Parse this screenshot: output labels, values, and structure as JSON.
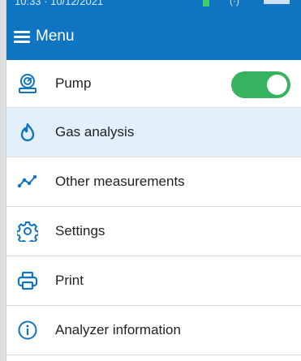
{
  "status_bar": {
    "time": "10:33 · 10/12/2021",
    "signal": "(·)"
  },
  "header": {
    "title": "Menu",
    "menu_icon": "hamburger-menu-icon"
  },
  "menu": {
    "items": [
      {
        "label": "Pump",
        "icon": "pump-icon",
        "toggle_on": true
      },
      {
        "label": "Gas analysis",
        "icon": "flame-icon",
        "active": true
      },
      {
        "label": "Other measurements",
        "icon": "line-graph-icon"
      },
      {
        "label": "Settings",
        "icon": "gear-icon"
      },
      {
        "label": "Print",
        "icon": "printer-icon"
      },
      {
        "label": "Analyzer information",
        "icon": "info-icon"
      }
    ]
  },
  "colors": {
    "header": "#0f75c2",
    "accent_icon": "#0f75c2",
    "active_row": "#e1f0fb",
    "toggle_on": "#37b25f"
  }
}
